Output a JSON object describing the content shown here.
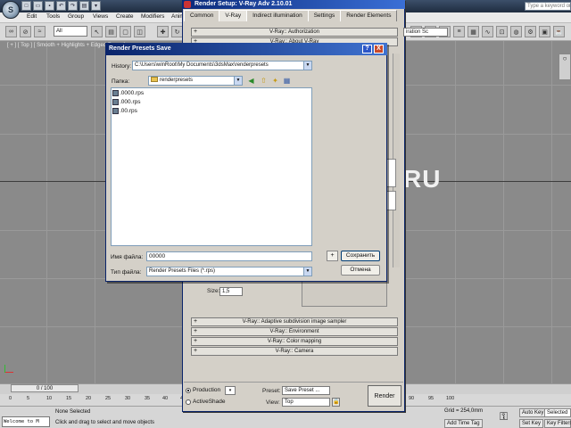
{
  "app": {
    "logo": "S",
    "search_placeholder": "Type a keyword or phrase",
    "menu": [
      "Edit",
      "Tools",
      "Group",
      "Views",
      "Create",
      "Modifiers",
      "Anim"
    ],
    "toolbar": {
      "selection_filter": "All"
    },
    "viewport_label": "[ + ] [ Top ] [ Smooth + Highlights + Edged Faces ]",
    "viewport_watermark": "RU",
    "timeline": {
      "slider": "0 / 100"
    },
    "track_ticks": [
      "0",
      "5",
      "10",
      "15",
      "20",
      "25",
      "30",
      "35",
      "40",
      "45",
      "90",
      "95",
      "100"
    ],
    "status": {
      "maxscript": "Welcome to M",
      "selection": "None Selected",
      "prompt": "Click and drag to select and move objects",
      "grid": "Grid = 254,0mm",
      "auto_key": "Auto Key",
      "selected": "Selected",
      "set_key": "Set Key",
      "key_filters": "Key Filters...",
      "add_time_tag": "Add Time Tag"
    }
  },
  "render_setup": {
    "title": "Render Setup: V-Ray Adv 2.10.01",
    "tabs": [
      "Common",
      "V-Ray",
      "Indirect illumination",
      "Settings",
      "Render Elements"
    ],
    "active_tab": "V-Ray",
    "rollouts_top": [
      "V-Ray:: Authorization",
      "V-Ray:: About V-Ray"
    ],
    "rollouts_bottom": [
      "V-Ray:: Adaptive subdivision image sampler",
      "V-Ray:: Environment",
      "V-Ray:: Color mapping",
      "V-Ray:: Camera"
    ],
    "size_label": "Size:",
    "size_value": "1,5",
    "production": "Production",
    "activeshade": "ActiveShade",
    "preset_label": "Preset:",
    "preset_value": "Save Preset ...",
    "view_label": "View:",
    "view_value": "Top",
    "render_button": "Render",
    "side_label": "iration Sc"
  },
  "dialog": {
    "title": "Render Presets Save",
    "help": "?",
    "close": "X",
    "history_label": "History:",
    "history_value": "C:\\Users\\winRoot\\My Documents\\3dsMax\\renderpresets",
    "folder_label": "Папка:",
    "folder_value": "renderpresets",
    "files": [
      ".0000.rps",
      ".000.rps",
      ".00.rps"
    ],
    "filename_label": "Имя файла:",
    "filename_value": "00000",
    "filetype_label": "Тип файла:",
    "filetype_value": "Render Presets Files (*.rps)",
    "plus_button": "+",
    "save_button": "Сохранить",
    "cancel_button": "Отмена"
  }
}
